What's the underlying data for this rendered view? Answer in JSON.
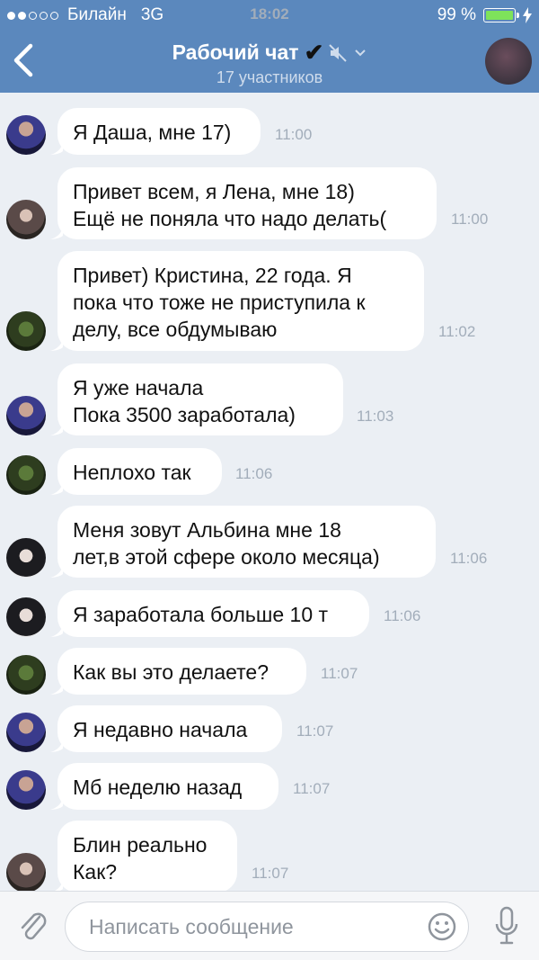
{
  "status": {
    "carrier": "Билайн",
    "network": "3G",
    "time": "18:02",
    "battery": "99 %",
    "battery_level": 0.99,
    "signal_bars": 2
  },
  "header": {
    "title": "Рабочий чат",
    "title_mark": "✔",
    "subtitle": "17 участников"
  },
  "messages": [
    {
      "text": "Я Даша, мне 17)",
      "time": "11:00",
      "avatar": "a"
    },
    {
      "text": "Привет всем, я Лена, мне 18)\nЕщё не поняла что надо делать(",
      "time": "11:00",
      "avatar": "b"
    },
    {
      "text": "Привет) Кристина, 22 года. Я\nпока что тоже не приступила к\nделу, все обдумываю",
      "time": "11:02",
      "avatar": "c"
    },
    {
      "text": "Я уже начала\nПока 3500 заработала)",
      "time": "11:03",
      "avatar": "a"
    },
    {
      "text": "Неплохо так",
      "time": "11:06",
      "avatar": "c"
    },
    {
      "text": "Меня зовут Альбина мне 18\nлет,в этой сфере около месяца)",
      "time": "11:06",
      "avatar": "d"
    },
    {
      "text": "Я заработала больше 10 т",
      "time": "11:06",
      "avatar": "d"
    },
    {
      "text": "Как вы это делаете?",
      "time": "11:07",
      "avatar": "c"
    },
    {
      "text": "Я недавно начала",
      "time": "11:07",
      "avatar": "a"
    },
    {
      "text": "Мб неделю назад",
      "time": "11:07",
      "avatar": "a"
    },
    {
      "text": "Блин реально\nКак?",
      "time": "11:07",
      "avatar": "b"
    }
  ],
  "composer": {
    "placeholder": "Написать сообщение"
  },
  "icons": {
    "back": "chevron-left-icon",
    "mute": "muted-speaker-icon",
    "attach": "paperclip-icon",
    "emoji": "smile-icon",
    "mic": "microphone-icon"
  },
  "colors": {
    "header": "#5b88bd",
    "background": "#ebeff4",
    "bubble": "#ffffff",
    "time": "#a2adba"
  }
}
